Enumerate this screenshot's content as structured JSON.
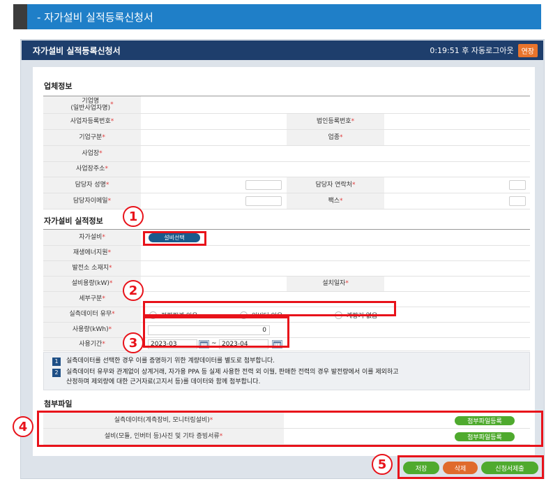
{
  "banner": {
    "title": "- 자가설비 실적등록신청서"
  },
  "window": {
    "title": "자가설비 실적등록신청서",
    "timer": "0:19:51 후 자동로그아웃",
    "extend_label": "연장"
  },
  "company": {
    "section_title": "업체정보",
    "labels": {
      "name": "기업명\n(일반사업자명)",
      "biz_no": "사업자등록번호",
      "corp_no": "법인등록번호",
      "type": "기업구분",
      "industry": "업종",
      "site": "사업장",
      "address": "사업장주소",
      "manager": "담당자 성명",
      "manager_phone": "담당자 연락처",
      "manager_email": "담당자이메일",
      "fax": "팩스"
    }
  },
  "facility": {
    "section_title": "자가설비 실적정보",
    "labels": {
      "facility": "자가설비",
      "source": "재생에너지원",
      "location": "발전소 소재지",
      "capacity": "설비용량(kW)",
      "install_date": "설치일자",
      "subtype": "세부구분",
      "measure": "실측데이터 유무",
      "usage": "사용량(kWh)",
      "period": "사용기간"
    },
    "select_button": "설비선택",
    "measure_options": [
      "전력량계 있음",
      "인버터 있음",
      "계량기 없음"
    ],
    "usage_value": "0",
    "period_start": "2023-03",
    "period_sep": "~",
    "period_end": "2023-04"
  },
  "notices": [
    {
      "num": "1",
      "text": "실측데이터를 선택한 경우 이를 증명하기 위한 계량데이터를 별도로 첨부합니다."
    },
    {
      "num": "2",
      "text": "실측데이터 유무와 관계없이 상계거래, 자가용 PPA 등 실제 사용한 전력 외 이월, 판매한 전력의 경우 발전량에서 이를 제외하고\n산정하며 제외량에 대한 근거자료(고지서 등)를 데이터와 함께 첨부합니다."
    }
  ],
  "attachments": {
    "section_title": "첨부파일",
    "rows": [
      {
        "label": "실측데이터(계측장비, 모니터링설비)",
        "button": "첨부파일등록"
      },
      {
        "label": "설비(모듈, 인버터 등)사진 및 기타 증빙서류",
        "button": "첨부파일등록"
      }
    ]
  },
  "actions": {
    "save": "저장",
    "delete": "삭제",
    "submit": "신청서제출"
  },
  "required_mark": "*",
  "callouts": [
    "1",
    "2",
    "3",
    "4",
    "5"
  ],
  "colors": {
    "header_navy": "#1e3e6c",
    "banner_blue": "#1f7fc8",
    "accent_orange": "#e06a2c",
    "accent_green": "#4faa2e",
    "callout_red": "#e8121a"
  }
}
